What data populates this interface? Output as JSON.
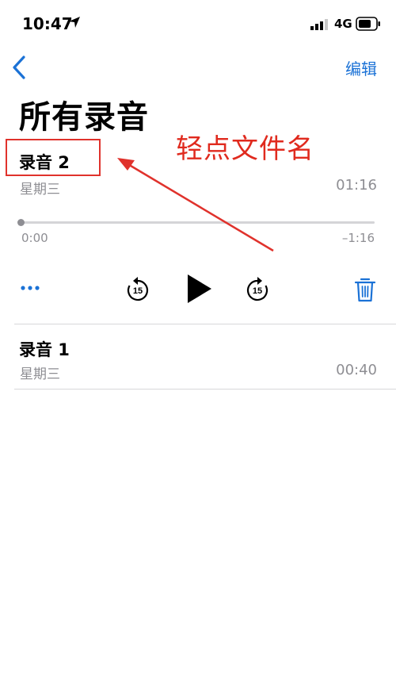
{
  "status_bar": {
    "time": "10:47",
    "network": "4G",
    "icons": [
      "location-arrow-icon",
      "signal-bars-icon",
      "battery-icon"
    ]
  },
  "nav": {
    "back_icon": "chevron-left-icon",
    "edit_label": "编辑"
  },
  "page_title": "所有录音",
  "recordings": [
    {
      "name": "录音 2",
      "day": "星期三",
      "duration": "01:16",
      "expanded": true,
      "player": {
        "elapsed": "0:00",
        "remaining": "–1:16",
        "progress": 0,
        "controls": [
          "more-icon",
          "skip-back-15-icon",
          "play-icon",
          "skip-forward-15-icon",
          "trash-icon"
        ],
        "skip_seconds": "15"
      }
    },
    {
      "name": "录音 1",
      "day": "星期三",
      "duration": "00:40",
      "expanded": false
    }
  ],
  "annotation": {
    "text": "轻点文件名",
    "color": "#e02a1e"
  },
  "colors": {
    "accent": "#1b72d6",
    "secondary_text": "#8e8e93",
    "annotation": "#e0322c"
  }
}
